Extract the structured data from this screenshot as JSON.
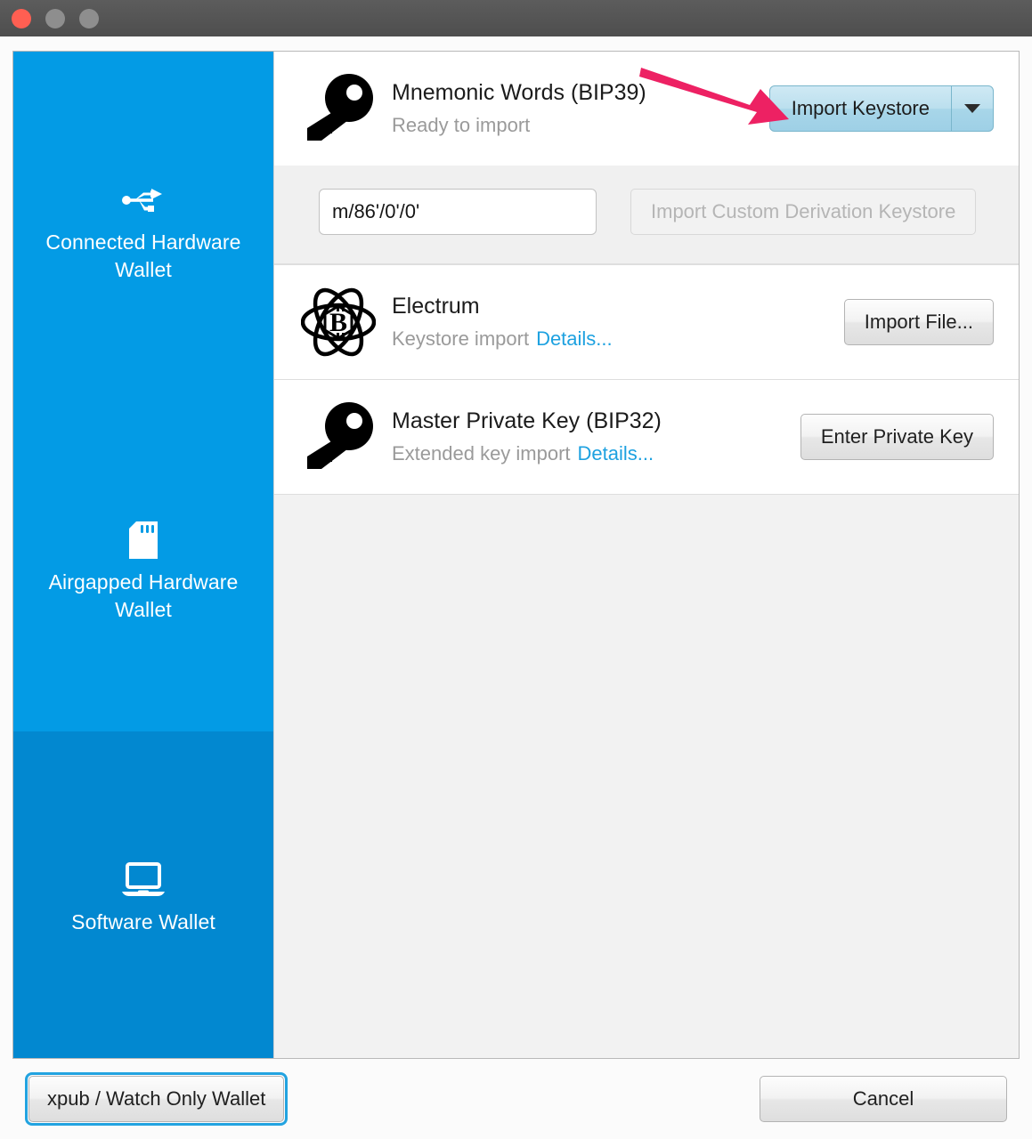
{
  "window": {
    "controls": [
      "close",
      "minimize",
      "maximize"
    ],
    "control_colors": {
      "close": "#ff5f52",
      "minimize": "#8e8e8e",
      "maximize": "#8e8e8e"
    }
  },
  "theme": {
    "sidebar_blue": "#039be5",
    "sidebar_selected_blue": "#0288d0",
    "link_blue": "#1da1e0",
    "accent_button_blue": "#a8d6e9",
    "annotation_pink": "#ed2163",
    "focus_ring": "#22a3e0"
  },
  "sidebar": {
    "items": [
      {
        "id": "connected-hardware-wallet",
        "label": "Connected Hardware Wallet",
        "icon": "usb-icon",
        "selected": false
      },
      {
        "id": "airgapped-hardware-wallet",
        "label": "Airgapped Hardware Wallet",
        "icon": "sdcard-icon",
        "selected": false
      },
      {
        "id": "software-wallet",
        "label": "Software Wallet",
        "icon": "laptop-icon",
        "selected": true
      }
    ]
  },
  "main": {
    "sections": [
      {
        "id": "mnemonic-words",
        "icon": "key-icon",
        "title": "Mnemonic Words (BIP39)",
        "subtitle": "Ready to import",
        "details_link": "",
        "action": {
          "type": "split-button",
          "label": "Import Keystore",
          "dropdown_icon": "chevron-down-icon",
          "highlighted": true
        },
        "expanded": true
      },
      {
        "id": "electrum",
        "icon": "electrum-icon",
        "title": "Electrum",
        "subtitle": "Keystore import",
        "details_link": "Details...",
        "action": {
          "type": "button",
          "label": "Import File...",
          "highlighted": false
        },
        "expanded": false
      },
      {
        "id": "master-private-key",
        "icon": "key-icon",
        "title": "Master Private Key (BIP32)",
        "subtitle": "Extended key import",
        "details_link": "Details...",
        "action": {
          "type": "button",
          "label": "Enter Private Key",
          "highlighted": false
        },
        "expanded": false
      }
    ],
    "subpanel": {
      "derivation_path_value": "m/86'/0'/0'",
      "derivation_path_placeholder": "m/86'/0'/0'",
      "custom_import_label": "Import Custom Derivation Keystore",
      "custom_import_disabled": true
    }
  },
  "footer": {
    "xpub_button_label": "xpub / Watch Only Wallet",
    "xpub_button_focused": true,
    "cancel_button_label": "Cancel"
  },
  "annotation": {
    "arrow": {
      "target": "Import Keystore",
      "color": "#ed2163"
    }
  }
}
